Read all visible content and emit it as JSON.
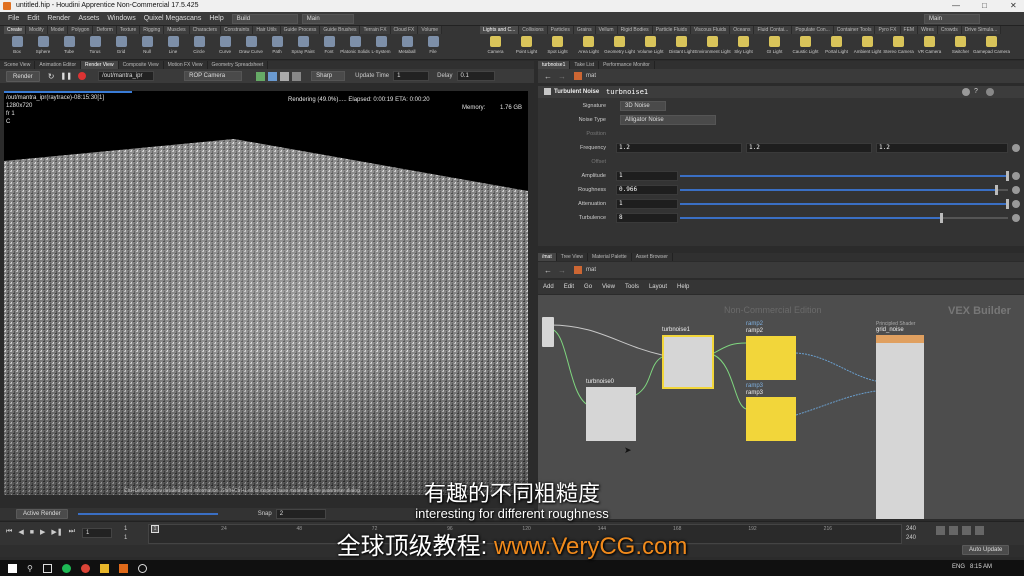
{
  "window": {
    "title": "untitled.hip - Houdini Apprentice Non-Commercial 17.5.425"
  },
  "menubar": {
    "items": [
      "File",
      "Edit",
      "Render",
      "Assets",
      "Windows",
      "Quixel Megascans",
      "Help"
    ],
    "desktop_left": "Build",
    "desktop_mid": "Main",
    "desktop_right": "Main"
  },
  "shelf": {
    "left_tabs": [
      "Create",
      "Modify",
      "Model",
      "Polygon",
      "Deform",
      "Texture",
      "Rigging",
      "Muscles",
      "Characters",
      "Constraints",
      "Hair Utils",
      "Guide Process",
      "Guide Brushes",
      "Terrain FX",
      "Cloud FX",
      "Volume"
    ],
    "left_tools": [
      "Box",
      "Sphere",
      "Tube",
      "Torus",
      "Grid",
      "Null",
      "Line",
      "Circle",
      "Curve",
      "Draw Curve",
      "Path",
      "Spray Paint",
      "Font",
      "Platonic Solids",
      "L-System",
      "Metaball",
      "File"
    ],
    "right_tabs": [
      "Lights and C...",
      "Collisions",
      "Particles",
      "Grains",
      "Vellum",
      "Rigid Bodies",
      "Particle Fluids",
      "Viscous Fluids",
      "Oceans",
      "Fluid Contai...",
      "Populate Con...",
      "Container Tools",
      "Pyro FX",
      "FEM",
      "Wires",
      "Crowds",
      "Drive Simula..."
    ],
    "right_tools": [
      "Camera",
      "Point Light",
      "Spot Light",
      "Area Light",
      "Geometry Light",
      "Volume Light",
      "Distant Light",
      "Environment Light",
      "Sky Light",
      "GI Light",
      "Caustic Light",
      "Portal Light",
      "Ambient Light",
      "Stereo Camera",
      "VR Camera",
      "Switcher",
      "Gamepad Camera"
    ]
  },
  "left_pane": {
    "tabs": [
      "Scene View",
      "Animation Editor",
      "Render View",
      "Composite View",
      "Motion FX View",
      "Geometry Spreadsheet"
    ],
    "active_tab": "Render View",
    "render_button": "Render",
    "rop_path": "/out/mantra_ipr",
    "camera": "ROP Camera",
    "sharp": "Sharp",
    "update_time_label": "Update Time",
    "update_time_value": "1",
    "delay_label": "Delay",
    "delay_value": "0.1",
    "render_title": "/out/mantra_ipr(raytrace)-08:15:30[1]",
    "resolution": "1280x720",
    "frame": "fr 1",
    "channel": "C",
    "render_status": "Rendering (49.0%)..... Elapsed: 0:00:19   ETA: 0:00:20",
    "memory_label": "Memory:",
    "memory_value": "1.76 GB",
    "render_progress": 0.49,
    "hint": "Ctrl+Left to show detailed pixel information. Shift+Ctrl+Left to inspect base material in the parameter dialog.",
    "active_render": "Active Render",
    "snap_label": "Snap",
    "snap_value": "2"
  },
  "param_pane": {
    "tabs": [
      "turbnoise1",
      "Take List",
      "Performance Monitor"
    ],
    "path": "mat",
    "node_type": "Turbulent Noise",
    "node_name": "turbnoise1",
    "signature_label": "Signature",
    "signature_value": "3D Noise",
    "noise_type_label": "Noise Type",
    "noise_type_value": "Alligator Noise",
    "position_label": "Position",
    "frequency_label": "Frequency",
    "frequency_values": [
      "1.2",
      "1.2",
      "1.2"
    ],
    "offset_label": "Offset",
    "amplitude_label": "Amplitude",
    "amplitude_value": "1",
    "amplitude_slider": 1.0,
    "roughness_label": "Roughness",
    "roughness_value": "0.966",
    "roughness_slider": 0.966,
    "attenuation_label": "Attenuation",
    "attenuation_value": "1",
    "attenuation_slider": 1.0,
    "turbulence_label": "Turbulence",
    "turbulence_value": "8",
    "turbulence_slider": 0.8
  },
  "network_pane": {
    "tabs": [
      "/mat",
      "Tree View",
      "Material Palette",
      "Asset Browser"
    ],
    "path": "mat",
    "menu": [
      "Add",
      "Edit",
      "Go",
      "View",
      "Tools",
      "Layout",
      "Help"
    ],
    "watermark": "Non-Commercial Edition",
    "context_label": "VEX Builder",
    "nodes": {
      "turbnoise1": "turbnoise1",
      "turbnoise0": "turbnoise0",
      "ramp2": "ramp2",
      "ramp3": "ramp3",
      "shader_type": "Principled Shader",
      "shader_name": "grid_noise"
    }
  },
  "timeline": {
    "ticks": [
      "24",
      "48",
      "72",
      "96",
      "120",
      "144",
      "168",
      "192",
      "216"
    ],
    "start_frame": "1",
    "start_frame_b": "1",
    "end_frame": "240",
    "end_frame_b": "240",
    "current_frame": "1",
    "playhead_tick": "1",
    "auto_update": "Auto Update"
  },
  "taskbar": {
    "time": "8:15 AM",
    "lang": "ENG"
  },
  "subtitles": {
    "cn": "有趣的不同粗糙度",
    "en": "interesting for different roughness",
    "brand_cn": "全球顶级教程:",
    "brand_url": "www.VeryCG.com"
  },
  "colors": {
    "accent": "#3a6fc4",
    "node_yellow": "#f2d63a",
    "node_gray": "#d6d6d6",
    "wire_green": "#7fd67f",
    "brand_orange": "#f08a1c"
  }
}
